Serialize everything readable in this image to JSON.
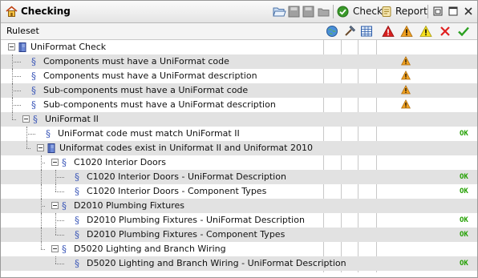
{
  "window": {
    "title": "Checking"
  },
  "toolbar": {
    "check_label": "Check",
    "report_label": "Report"
  },
  "columns": {
    "ruleset_label": "Ruleset"
  },
  "tree": [
    {
      "label": "UniFormat Check",
      "level": 0,
      "kind": "book",
      "expander": true,
      "status": ""
    },
    {
      "label": "Components must have a UniFormat code",
      "level": 1,
      "kind": "rule",
      "status": "warning"
    },
    {
      "label": "Components must have a UniFormat description",
      "level": 1,
      "kind": "rule",
      "status": "warning"
    },
    {
      "label": "Sub-components must have a UniFormat code",
      "level": 1,
      "kind": "rule",
      "status": "warning"
    },
    {
      "label": "Sub-components must have a UniFormat description",
      "level": 1,
      "kind": "rule",
      "status": "warning"
    },
    {
      "label": "UniFormat II",
      "level": 1,
      "kind": "rule",
      "expander": true,
      "status": ""
    },
    {
      "label": "UniFormat code must match UniFormat II",
      "level": 2,
      "kind": "rule",
      "status": "OK"
    },
    {
      "label": "Uniformat codes exist in Uniformat II and Uniformat 2010",
      "level": 2,
      "kind": "book",
      "expander": true,
      "status": ""
    },
    {
      "label": "C1020 Interior Doors",
      "level": 3,
      "kind": "rule",
      "expander": true,
      "status": ""
    },
    {
      "label": "C1020 Interior Doors - UniFormat Description",
      "level": 4,
      "kind": "rule",
      "status": "OK"
    },
    {
      "label": "C1020 Interior Doors - Component Types",
      "level": 4,
      "kind": "rule",
      "status": "OK"
    },
    {
      "label": "D2010 Plumbing Fixtures",
      "level": 3,
      "kind": "rule",
      "expander": true,
      "status": ""
    },
    {
      "label": "D2010 Plumbing Fixtures - UniFormat Description",
      "level": 4,
      "kind": "rule",
      "status": "OK"
    },
    {
      "label": "D2010 Plumbing Fixtures - Component Types",
      "level": 4,
      "kind": "rule",
      "status": "OK"
    },
    {
      "label": "D5020 Lighting and Branch Wiring",
      "level": 3,
      "kind": "rule",
      "expander": true,
      "status": ""
    },
    {
      "label": "D5020 Lighting and Branch Wiring - UniFormat Description",
      "level": 4,
      "kind": "rule",
      "status": "OK"
    }
  ]
}
